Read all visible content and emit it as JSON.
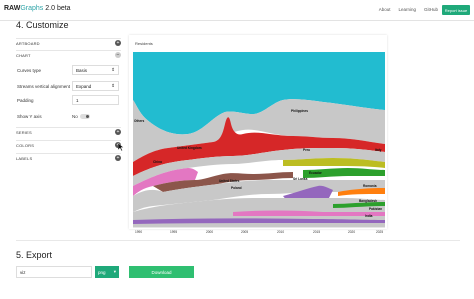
{
  "app": {
    "logo_bold": "RAW",
    "logo_accent": "Graphs",
    "logo_version": "2.0 beta",
    "nav": [
      "About",
      "Learning",
      "GitHub"
    ],
    "report_button": "Report issue"
  },
  "customize": {
    "heading": "4. Customize",
    "panels": {
      "artboard": "ARTBOARD",
      "chart": "CHART",
      "series": "SERIES",
      "colors": "COLORS",
      "labels": "LABELS"
    },
    "options": {
      "curves_type_label": "Curves type",
      "curves_type_value": "Basis",
      "streams_alignment_label": "Streams vertical alignment",
      "streams_alignment_value": "Expand",
      "padding_label": "Padding",
      "padding_value": "1",
      "show_y_axis_label": "Show Y axis",
      "show_y_axis_value": "No"
    }
  },
  "chart": {
    "title": "Residents",
    "x_ticks": [
      "1990",
      "1995",
      "2000",
      "2005",
      "2010",
      "2015",
      "2020",
      "2025",
      "2030",
      "2035",
      "2040",
      "2045"
    ],
    "stream_labels": [
      "Others",
      "Philippines",
      "Italy",
      "Peru",
      "China",
      "United Kingdom",
      "Ecuador",
      "Sri Lanka",
      "United States",
      "Poland",
      "Romania",
      "Bangladesh",
      "Pakistan",
      "India"
    ],
    "colors": {
      "cyan": "#22bcd0",
      "grey": "#c8c8c8",
      "red": "#d62728",
      "pink": "#e377c2",
      "brown": "#8c564b",
      "green": "#2ca02c",
      "olive": "#bcbd22",
      "purple": "#9467bd",
      "orange": "#ff7f0e",
      "blue": "#1f77b4",
      "lightgreen": "#98df8a"
    }
  },
  "export": {
    "heading": "5. Export",
    "filename_value": "viz",
    "format_value": "png",
    "download_label": "Download"
  }
}
